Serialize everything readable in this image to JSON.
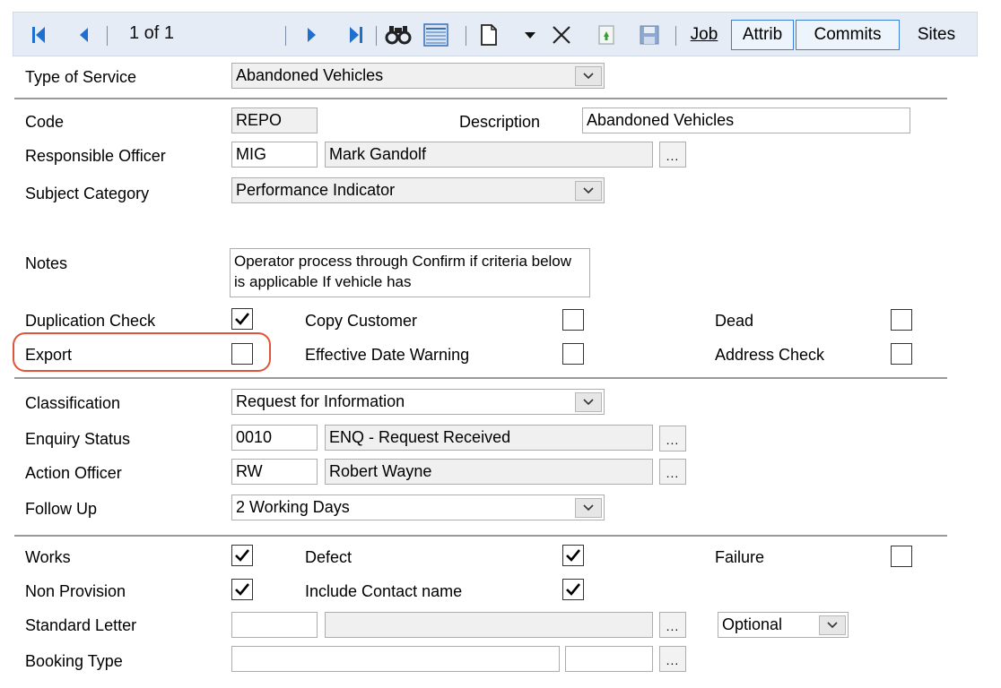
{
  "toolbar": {
    "record_position": "1 of 1",
    "job_label": "Job",
    "attrib_label": "Attrib",
    "commits_label": "Commits",
    "sites_label": "Sites",
    "icons": [
      "first-record-icon",
      "previous-record-icon",
      "next-record-icon",
      "last-record-icon",
      "find-icon",
      "list-view-icon",
      "new-record-icon",
      "dropdown-arrow-icon",
      "delete-icon",
      "copy-icon",
      "save-icon"
    ]
  },
  "type_of_service": {
    "label": "Type of Service",
    "value": "Abandoned Vehicles"
  },
  "code": {
    "label": "Code",
    "value": "REPO"
  },
  "description": {
    "label": "Description",
    "value": "Abandoned Vehicles"
  },
  "responsible_officer": {
    "label": "Responsible Officer",
    "code": "MIG",
    "name": "Mark Gandolf"
  },
  "subject_category": {
    "label": "Subject Category",
    "value": "Performance Indicator"
  },
  "notes": {
    "label": "Notes",
    "value": "Operator process through Confirm if criteria below is applicable If vehicle has"
  },
  "checks": {
    "duplication_check": {
      "label": "Duplication Check",
      "checked": true
    },
    "copy_customer": {
      "label": "Copy Customer",
      "checked": false
    },
    "dead": {
      "label": "Dead",
      "checked": false
    },
    "export": {
      "label": "Export",
      "checked": false
    },
    "effective_date_warning": {
      "label": "Effective Date Warning",
      "checked": false
    },
    "address_check": {
      "label": "Address Check",
      "checked": false
    }
  },
  "classification": {
    "label": "Classification",
    "value": "Request for Information"
  },
  "enquiry_status": {
    "label": "Enquiry Status",
    "code": "0010",
    "name": "ENQ - Request Received"
  },
  "action_officer": {
    "label": "Action Officer",
    "code": "RW",
    "name": "Robert Wayne"
  },
  "follow_up": {
    "label": "Follow Up",
    "value": "2 Working Days"
  },
  "flags": {
    "works": {
      "label": "Works",
      "checked": true
    },
    "defect": {
      "label": "Defect",
      "checked": true
    },
    "failure": {
      "label": "Failure",
      "checked": false
    },
    "non_provision": {
      "label": "Non Provision",
      "checked": true
    },
    "include_contact_name": {
      "label": "Include Contact name",
      "checked": true
    }
  },
  "standard_letter": {
    "label": "Standard Letter",
    "code": "",
    "name": "",
    "option": "Optional"
  },
  "booking_type": {
    "label": "Booking Type",
    "value1": "",
    "value2": ""
  },
  "ellipsis_label": "...",
  "colors": {
    "toolbar_bg": "#e5ecf6",
    "toolbar_icon": "#1e6fd0",
    "highlight": "#e0553a",
    "field_bg": "#f0f0f0"
  }
}
